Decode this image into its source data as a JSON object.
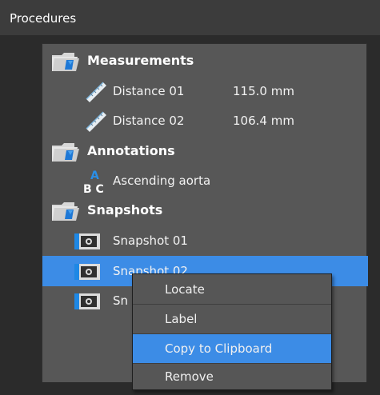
{
  "panel": {
    "title": "Procedures"
  },
  "tree": {
    "groups": [
      {
        "label": "Measurements",
        "icon": "folder-icon",
        "items": [
          {
            "label": "Distance 01",
            "value": "115.0 mm",
            "icon": "ruler-icon"
          },
          {
            "label": "Distance 02",
            "value": "106.4 mm",
            "icon": "ruler-icon"
          }
        ]
      },
      {
        "label": "Annotations",
        "icon": "folder-icon",
        "items": [
          {
            "label": "Ascending aorta",
            "icon": "text-annotation-icon"
          }
        ]
      },
      {
        "label": "Snapshots",
        "icon": "folder-icon",
        "items": [
          {
            "label": "Snapshot 01",
            "icon": "camera-icon"
          },
          {
            "label": "Snapshot 02",
            "icon": "camera-icon",
            "selected": true
          },
          {
            "label": "Sn",
            "icon": "camera-icon"
          }
        ]
      }
    ]
  },
  "annotation_icon_text": {
    "top": "A",
    "bottom": "B C"
  },
  "context_menu": {
    "items": [
      "Locate",
      "Label",
      "Copy to Clipboard",
      "Remove"
    ],
    "highlighted": "Copy to Clipboard"
  },
  "colors": {
    "selection": "#3c8ce6",
    "panel_bg": "#575757",
    "header_bg": "#3c3c3c",
    "folder_blue": "#1e78d6"
  }
}
